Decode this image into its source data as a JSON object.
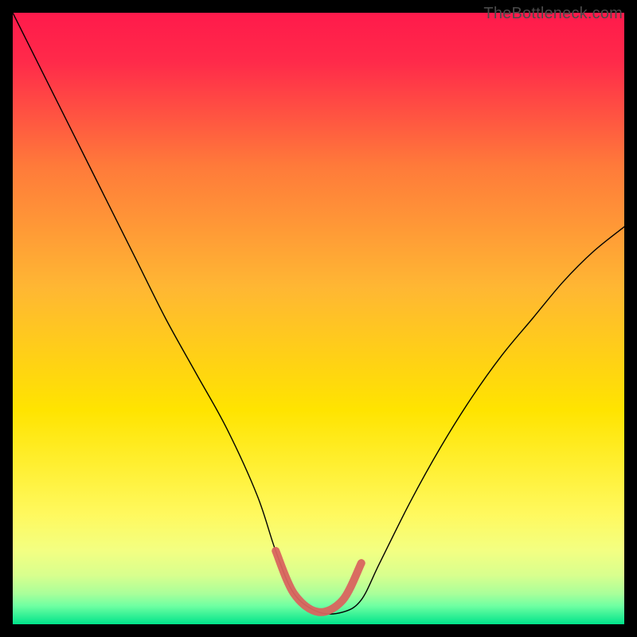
{
  "watermark": "TheBottleneck.com",
  "chart_data": {
    "type": "line",
    "title": "",
    "xlabel": "",
    "ylabel": "",
    "xlim": [
      0,
      100
    ],
    "ylim": [
      0,
      100
    ],
    "grid": false,
    "background_gradient": {
      "top_color": "#ff1a4b",
      "mid_color": "#ffe400",
      "bottom_colors": [
        "#f6ff7a",
        "#caff8e",
        "#7bffa6",
        "#00e38a"
      ]
    },
    "series": [
      {
        "name": "bottleneck-curve",
        "x": [
          0,
          5,
          10,
          15,
          20,
          25,
          30,
          35,
          40,
          43,
          46,
          50,
          54,
          57,
          60,
          65,
          70,
          75,
          80,
          85,
          90,
          95,
          100
        ],
        "y": [
          100,
          90,
          80,
          70,
          60,
          50,
          41,
          32,
          21,
          12,
          5,
          2,
          2,
          4,
          10,
          20,
          29,
          37,
          44,
          50,
          56,
          61,
          65
        ],
        "stroke": "#000000",
        "stroke_width": 1.4
      },
      {
        "name": "optimal-zone-highlight",
        "x": [
          43,
          46,
          50,
          54,
          57
        ],
        "y": [
          12,
          5,
          2,
          4,
          10
        ],
        "stroke": "#d9645f",
        "stroke_width": 10
      }
    ]
  }
}
